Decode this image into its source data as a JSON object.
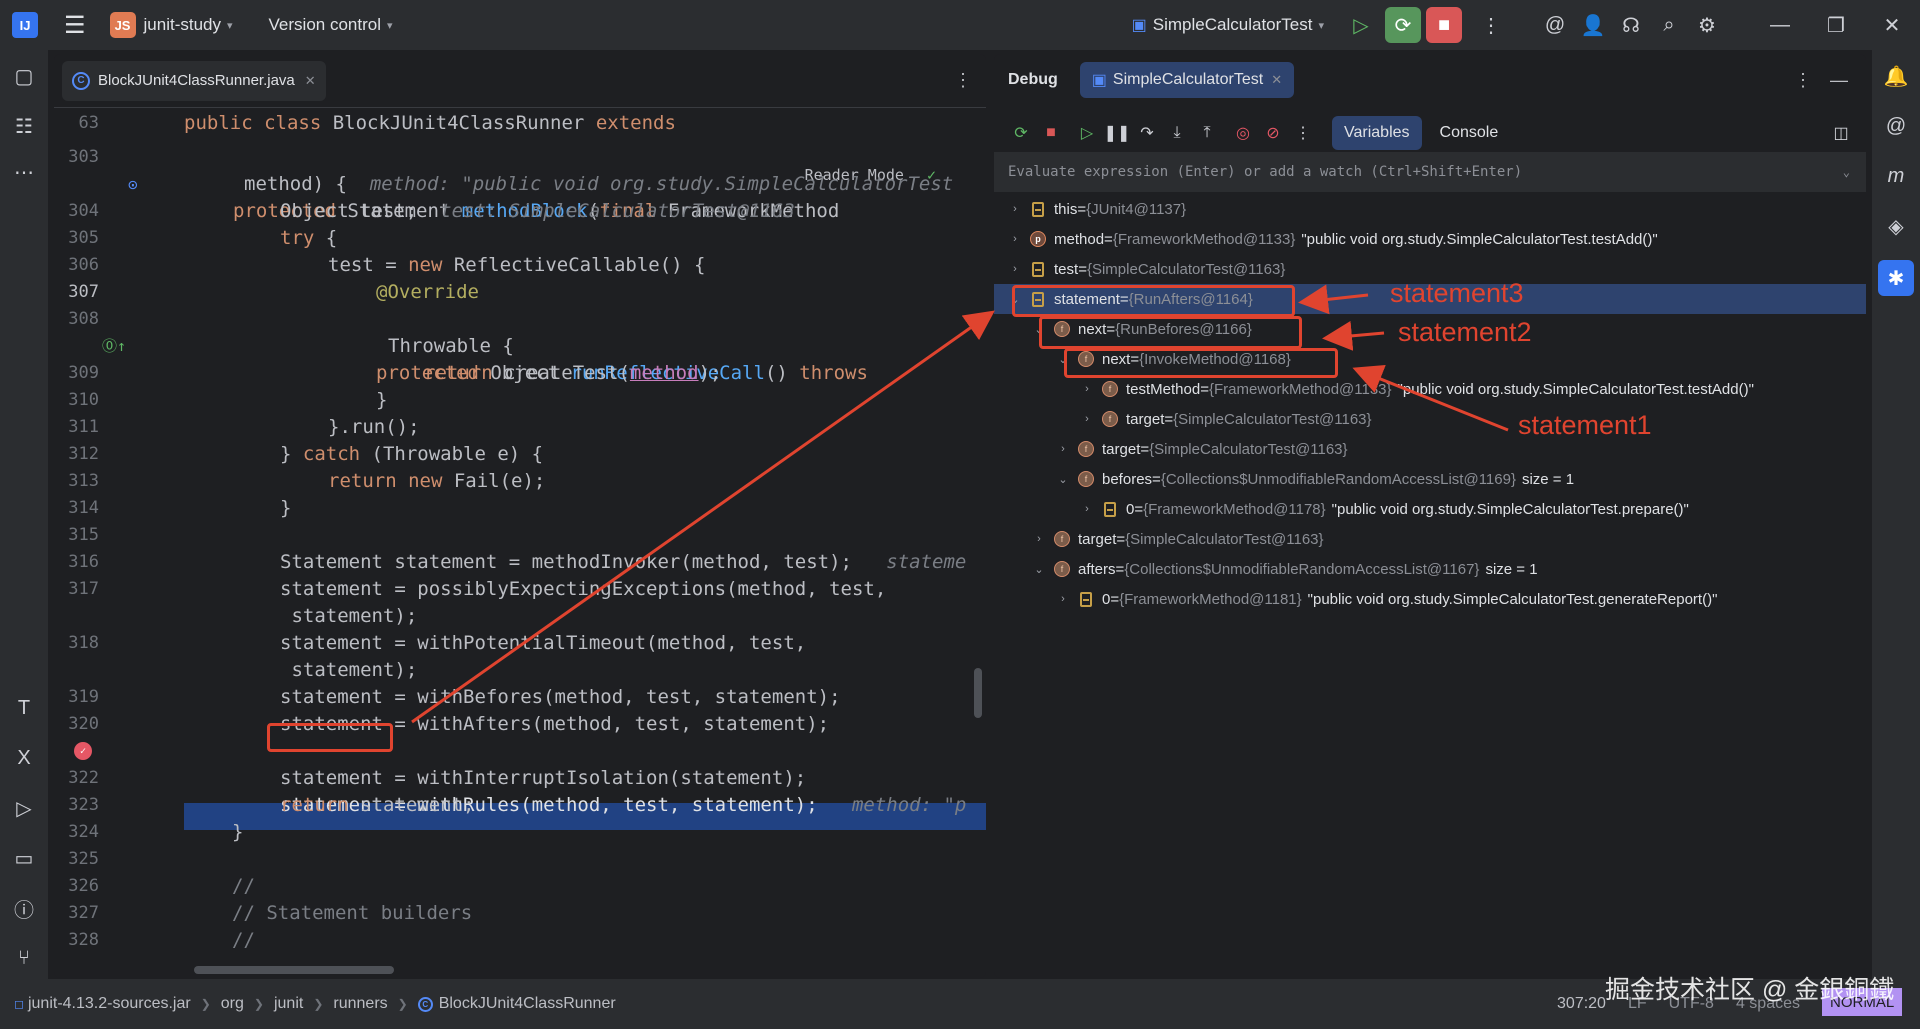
{
  "titlebar": {
    "logo_text": "IJ",
    "project_initials": "JS",
    "project_name": "junit-study",
    "vcs_label": "Version control",
    "run_config": "SimpleCalculatorTest"
  },
  "editor": {
    "tab_file": "BlockJUnit4ClassRunner.java",
    "reader_mode": "Reader Mode",
    "lines": [
      {
        "n": "63",
        "text": "public class BlockJUnit4ClassRunner extends"
      },
      {
        "n": "303",
        "text": "protected Statement methodBlock(final FrameworkMethod"
      },
      {
        "n": "",
        "text": " method) {",
        "hint": "method: \"public void org.study.SimpleCalculatorTest"
      },
      {
        "n": "304",
        "text": "Object test;",
        "hint": "test: SimpleCalculatorTest@1163"
      },
      {
        "n": "305",
        "text": "try {"
      },
      {
        "n": "306",
        "text": "test = new ReflectiveCallable() {"
      },
      {
        "n": "307",
        "text": "@Override"
      },
      {
        "n": "308",
        "text": "protected Object runReflectiveCall() throws"
      },
      {
        "n": "",
        "text": "Throwable {"
      },
      {
        "n": "309",
        "text": "return createTest(method);"
      },
      {
        "n": "310",
        "text": "}"
      },
      {
        "n": "311",
        "text": "}.run();"
      },
      {
        "n": "312",
        "text": "} catch (Throwable e) {"
      },
      {
        "n": "313",
        "text": "return new Fail(e);"
      },
      {
        "n": "314",
        "text": "}"
      },
      {
        "n": "315",
        "text": ""
      },
      {
        "n": "316",
        "text": "Statement statement = methodInvoker(method, test);",
        "hint": "stateme"
      },
      {
        "n": "317",
        "text": "statement = possiblyExpectingExceptions(method, test,"
      },
      {
        "n": "",
        "text": " statement);"
      },
      {
        "n": "318",
        "text": "statement = withPotentialTimeout(method, test,"
      },
      {
        "n": "",
        "text": " statement);"
      },
      {
        "n": "319",
        "text": "statement = withBefores(method, test, statement);"
      },
      {
        "n": "320",
        "text": "statement = withAfters(method, test, statement);"
      },
      {
        "n": "",
        "text": "statement = withRules(method, test, statement);",
        "hint": "method: \"p"
      },
      {
        "n": "322",
        "text": "statement = withInterruptIsolation(statement);"
      },
      {
        "n": "323",
        "text": "return statement;"
      },
      {
        "n": "324",
        "text": "}"
      },
      {
        "n": "325",
        "text": ""
      },
      {
        "n": "326",
        "text": "//"
      },
      {
        "n": "327",
        "text": "// Statement builders"
      },
      {
        "n": "328",
        "text": "//"
      }
    ]
  },
  "debug": {
    "title": "Debug",
    "session_tab": "SimpleCalculatorTest",
    "variables_tab": "Variables",
    "console_tab": "Console",
    "eval_placeholder": "Evaluate expression (Enter) or add a watch (Ctrl+Shift+Enter)",
    "rows": [
      {
        "name": "this",
        "type": "{JUnit4@1137}",
        "value": "",
        "icon": "field",
        "arrow": ">",
        "indent": 0
      },
      {
        "name": "method",
        "type": "{FrameworkMethod@1133}",
        "value": "\"public void org.study.SimpleCalculatorTest.testAdd()\"",
        "icon": "param",
        "arrow": ">",
        "indent": 0
      },
      {
        "name": "test",
        "type": "{SimpleCalculatorTest@1163}",
        "value": "",
        "icon": "field",
        "arrow": ">",
        "indent": 0
      },
      {
        "name": "statement",
        "type": "{RunAfters@1164}",
        "value": "",
        "icon": "field",
        "arrow": "v",
        "indent": 0,
        "selected": true
      },
      {
        "name": "next",
        "type": "{RunBefores@1166}",
        "value": "",
        "icon": "obj",
        "arrow": "v",
        "indent": 1
      },
      {
        "name": "next",
        "type": "{InvokeMethod@1168}",
        "value": "",
        "icon": "obj",
        "arrow": "v",
        "indent": 2
      },
      {
        "name": "testMethod",
        "type": "{FrameworkMethod@1133}",
        "value": "\"public void org.study.SimpleCalculatorTest.testAdd()\"",
        "icon": "obj",
        "arrow": ">",
        "indent": 3
      },
      {
        "name": "target",
        "type": "{SimpleCalculatorTest@1163}",
        "value": "",
        "icon": "obj",
        "arrow": ">",
        "indent": 3
      },
      {
        "name": "target",
        "type": "{SimpleCalculatorTest@1163}",
        "value": "",
        "icon": "obj",
        "arrow": ">",
        "indent": 2
      },
      {
        "name": "befores",
        "type": "{Collections$UnmodifiableRandomAccessList@1169}",
        "value": "size = 1",
        "icon": "obj",
        "arrow": "v",
        "indent": 2
      },
      {
        "name": "0",
        "type": "{FrameworkMethod@1178}",
        "value": "\"public void org.study.SimpleCalculatorTest.prepare()\"",
        "icon": "field",
        "arrow": ">",
        "indent": 3
      },
      {
        "name": "target",
        "type": "{SimpleCalculatorTest@1163}",
        "value": "",
        "icon": "obj",
        "arrow": ">",
        "indent": 1
      },
      {
        "name": "afters",
        "type": "{Collections$UnmodifiableRandomAccessList@1167}",
        "value": "size = 1",
        "icon": "obj",
        "arrow": "v",
        "indent": 1
      },
      {
        "name": "0",
        "type": "{FrameworkMethod@1181}",
        "value": "\"public void org.study.SimpleCalculatorTest.generateReport()\"",
        "icon": "field",
        "arrow": ">",
        "indent": 2
      }
    ]
  },
  "annotations": {
    "statement3": "statement3",
    "statement2": "statement2",
    "statement1": "statement1",
    "color": "#e0442f"
  },
  "statusbar": {
    "crumbs": [
      "junit-4.13.2-sources.jar",
      "org",
      "junit",
      "runners",
      "BlockJUnit4ClassRunner"
    ],
    "position": "307:20",
    "line_sep": "LF",
    "encoding": "UTF-8",
    "indent": "4 spaces",
    "mode": "NORMAL"
  },
  "watermark": "掘金技术社区 @ 金銀銅鐵"
}
